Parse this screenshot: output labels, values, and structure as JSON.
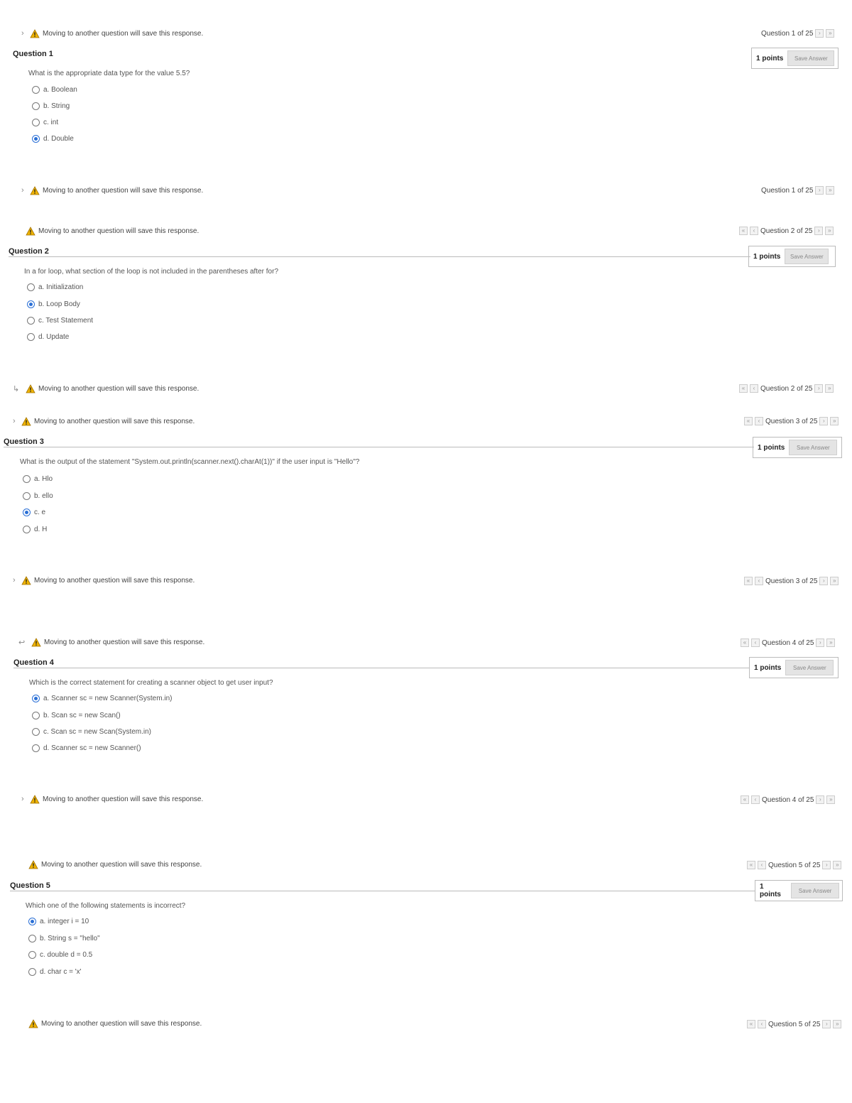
{
  "warning_text": "Moving to another question will save this response.",
  "points_label": "1 points",
  "save_label": "Save Answer",
  "nav": {
    "first": "«",
    "prev": "‹",
    "next": "›",
    "last": "»",
    "q1": "Question 1 of 25",
    "q2": "Question 2 of 25",
    "q3": "Question 3 of 25",
    "q4": "Question 4 of 25",
    "q5": "Question 5 of 25"
  },
  "questions": [
    {
      "title": "Question 1",
      "text": "What is the appropriate data type for the value 5.5?",
      "options": [
        "a. Boolean",
        "b. String",
        "c. int",
        "d. Double"
      ],
      "selected": 3
    },
    {
      "title": "Question 2",
      "text": "In a for loop, what section of the loop is not included in the parentheses after for?",
      "options": [
        "a. Initialization",
        "b. Loop Body",
        "c. Test Statement",
        "d. Update"
      ],
      "selected": 1
    },
    {
      "title": "Question 3",
      "text": "What is the output of the statement \"System.out.println(scanner.next().charAt(1))\" if the user input is \"Hello\"?",
      "options": [
        "a. Hlo",
        "b. ello",
        "c. e",
        "d. H"
      ],
      "selected": 2
    },
    {
      "title": "Question 4",
      "text": "Which is the correct statement for creating a scanner object to get user input?",
      "options": [
        "a. Scanner sc = new Scanner(System.in)",
        "b. Scan sc = new Scan()",
        "c. Scan sc = new Scan(System.in)",
        "d. Scanner sc = new Scanner()"
      ],
      "selected": 0
    },
    {
      "title": "Question 5",
      "text": "Which one of the following statements is incorrect?",
      "options": [
        "a. integer i = 10",
        "b. String s = \"hello\"",
        "c. double d = 0.5",
        "d. char c = 'x'"
      ],
      "selected": 0
    }
  ]
}
